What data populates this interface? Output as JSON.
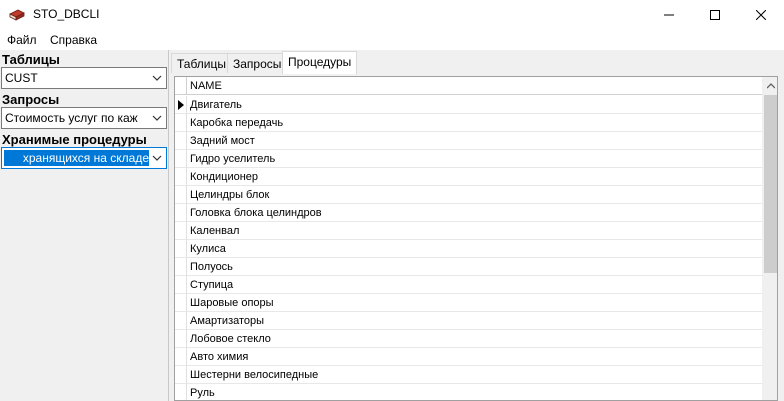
{
  "window": {
    "title": "STO_DBCLI"
  },
  "menu": [
    {
      "label": "Файл"
    },
    {
      "label": "Справка"
    }
  ],
  "left_panel": {
    "tables": {
      "label": "Таблицы",
      "value": "CUST"
    },
    "queries": {
      "label": "Запросы",
      "value": "Стоимость услуг по каж"
    },
    "procedures": {
      "label": "Хранимые  процедуры",
      "value": "хранящихся на складе"
    }
  },
  "tabs": [
    {
      "label": "Таблицы"
    },
    {
      "label": "Запросы"
    },
    {
      "label": "Процедуры",
      "active": true
    }
  ],
  "grid": {
    "column": "NAME",
    "rows": [
      "Двигатель",
      "Каробка передачь",
      "Задний мост",
      "Гидро уселитель",
      "Кондиционер",
      "Целиндры блок",
      "Головка блока целиндров",
      "Каленвал",
      "Кулиса",
      "Полуось",
      "Ступица",
      "Шаровые опоры",
      "Амартизаторы",
      "Лобовое стекло",
      "Авто химия",
      "Шестерни велосипедные",
      "Руль"
    ]
  },
  "icons": {
    "app": "books-icon",
    "minimize": "minimize-icon",
    "maximize": "maximize-icon",
    "close": "close-icon",
    "dropdown": "chevron-down-icon",
    "row_pointer": "current-row-arrow-icon",
    "scroll_up": "scroll-up-arrow-icon"
  },
  "colors": {
    "selection": "#0078d7",
    "scroll_thumb": "#cdcdcd"
  }
}
